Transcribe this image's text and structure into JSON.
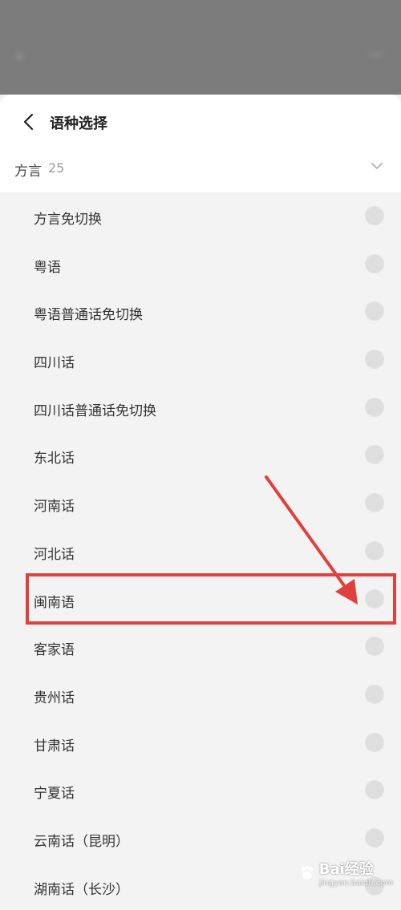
{
  "sheet": {
    "title": "语种选择",
    "section": {
      "label": "方言",
      "count": "25"
    }
  },
  "items": [
    {
      "label": "方言免切换"
    },
    {
      "label": "粤语"
    },
    {
      "label": "粤语普通话免切换"
    },
    {
      "label": "四川话"
    },
    {
      "label": "四川话普通话免切换"
    },
    {
      "label": "东北话"
    },
    {
      "label": "河南话"
    },
    {
      "label": "河北话"
    },
    {
      "label": "闽南语"
    },
    {
      "label": "客家语"
    },
    {
      "label": "贵州话"
    },
    {
      "label": "甘肃话"
    },
    {
      "label": "宁夏话"
    },
    {
      "label": "云南话（昆明）"
    },
    {
      "label": "湖南话（长沙）"
    }
  ],
  "annotation": {
    "highlighted_item": "闽南语",
    "color": "#e0403c"
  },
  "watermark": {
    "brand": "Bai",
    "tail": "经验",
    "sub": "jingyan.baidu.com"
  }
}
